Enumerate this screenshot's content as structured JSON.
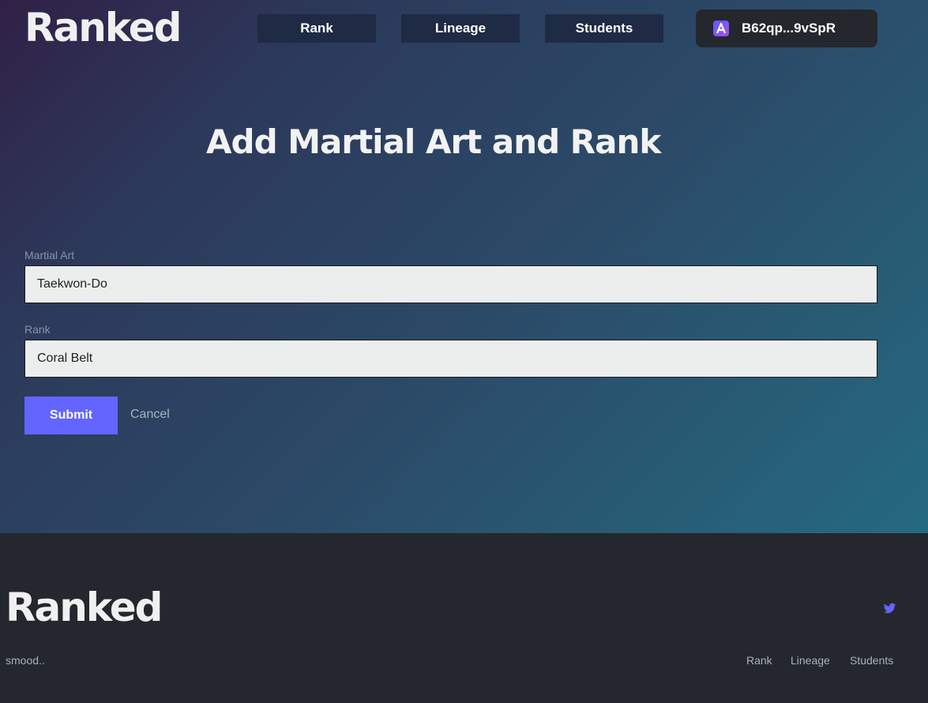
{
  "header": {
    "logo": "Ranked",
    "nav": [
      {
        "label": "Rank"
      },
      {
        "label": "Lineage"
      },
      {
        "label": "Students"
      }
    ],
    "wallet": {
      "address": "B62qp...9vSpR",
      "icon": "wallet-logo-icon"
    }
  },
  "main": {
    "title": "Add Martial Art and Rank",
    "form": {
      "martial_art": {
        "label": "Martial Art",
        "value": "Taekwon-Do"
      },
      "rank": {
        "label": "Rank",
        "value": "Coral Belt"
      },
      "submit_label": "Submit",
      "cancel_label": "Cancel"
    }
  },
  "footer": {
    "logo": "Ranked",
    "tagline": "smood..",
    "links": [
      {
        "label": "Rank"
      },
      {
        "label": "Lineage"
      },
      {
        "label": "Students"
      }
    ],
    "social_icon": "twitter-icon"
  },
  "colors": {
    "accent": "#6464ff",
    "nav_button_bg": "#1f2a44",
    "footer_bg": "#24272d",
    "input_bg": "#eceeee"
  }
}
